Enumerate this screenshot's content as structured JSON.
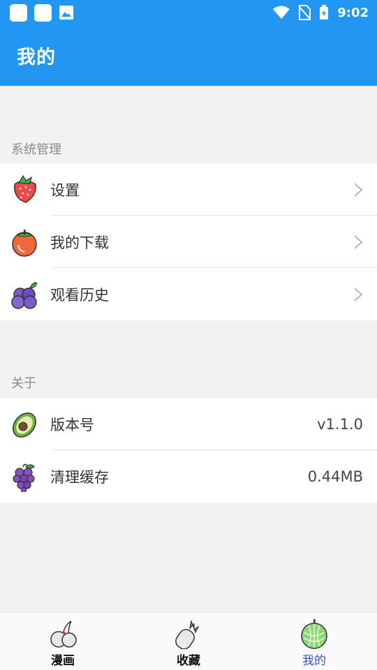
{
  "status_bar": {
    "time": "9:02",
    "icons": [
      "notification-square-icon",
      "notification-square-icon",
      "image-icon",
      "wifi-icon",
      "no-sim-icon",
      "battery-charging-icon"
    ]
  },
  "header": {
    "title": "我的"
  },
  "sections": [
    {
      "label": "系统管理",
      "items": [
        {
          "label": "设置",
          "icon": "strawberry-icon"
        },
        {
          "label": "我的下载",
          "icon": "persimmon-icon"
        },
        {
          "label": "观看历史",
          "icon": "blueberry-icon"
        }
      ]
    },
    {
      "label": "关于",
      "items": [
        {
          "label": "版本号",
          "value": "v1.1.0",
          "icon": "avocado-icon"
        },
        {
          "label": "清理缓存",
          "value": "0.44MB",
          "icon": "grape-icon"
        }
      ]
    }
  ],
  "tabs": [
    {
      "label": "漫画",
      "icon": "cherry-icon",
      "active": false
    },
    {
      "label": "收藏",
      "icon": "pineapple-icon",
      "active": false
    },
    {
      "label": "我的",
      "icon": "melon-icon",
      "active": true
    }
  ],
  "colors": {
    "primary": "#2196f3",
    "active_tab": "#3f51b5",
    "background": "#f2f2f2"
  }
}
